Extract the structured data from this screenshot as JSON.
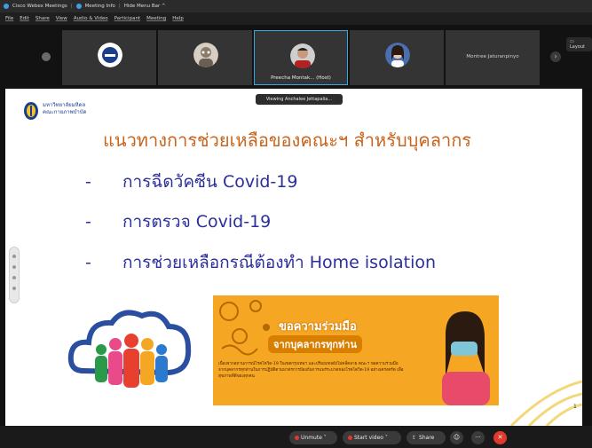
{
  "titlebar": {
    "app": "Cisco Webex Meetings",
    "meeting_info": "Meeting Info",
    "hide_menu": "Hide Menu Bar ^"
  },
  "menubar": {
    "items": [
      "File",
      "Edit",
      "Share",
      "View",
      "Audio & Video",
      "Participant",
      "Meeting",
      "Help"
    ]
  },
  "participants": {
    "host_name": "Preecha Montak... (Host)",
    "other_name": "Montree Jaturanpinyo",
    "layout_label": "Layout"
  },
  "viewing_banner": "Viewing Anchalee Jettapalia...",
  "slide": {
    "org_line1": "มหาวิทยาลัยมหิดล",
    "org_line2": "คณะกายภาพบำบัด",
    "title": "แนวทางการช่วยเหลือของคณะฯ สำหรับบุคลากร",
    "bullets": [
      "การฉีดวัคซีน Covid-19",
      "การตรวจ Covid-19",
      "การช่วยเหลือกรณีต้องทำ Home isolation"
    ],
    "bullet_dash": "-",
    "banner_head1": "ขอความร่วมมือ",
    "banner_head2": "จากบุคลากรทุกท่าน",
    "banner_body": "เนื่องจากสถานการณ์โรคโควิด-19 ในเขตกรุงเทพฯ และปริมณฑลยังไม่คลี่คลาย คณะฯ ขอความร่วมมือจากบุคลากรทุกท่านในการปฏิบัติตามมาตรการป้องกันการแพร่ระบาดของโรคโควิด-19 อย่างเคร่งครัด เพื่อสุขภาพที่ดีของทุกคน",
    "page_number": "1"
  },
  "controls": {
    "unmute": "Unmute",
    "start_video": "Start video",
    "share": "Share",
    "more": "···",
    "leave": "✕"
  },
  "colors": {
    "title": "#c8641c",
    "bullets": "#2a2f9c",
    "accent_blue": "#38a9e0",
    "banner_bg": "#f5a623",
    "leave_red": "#e03a2e"
  }
}
